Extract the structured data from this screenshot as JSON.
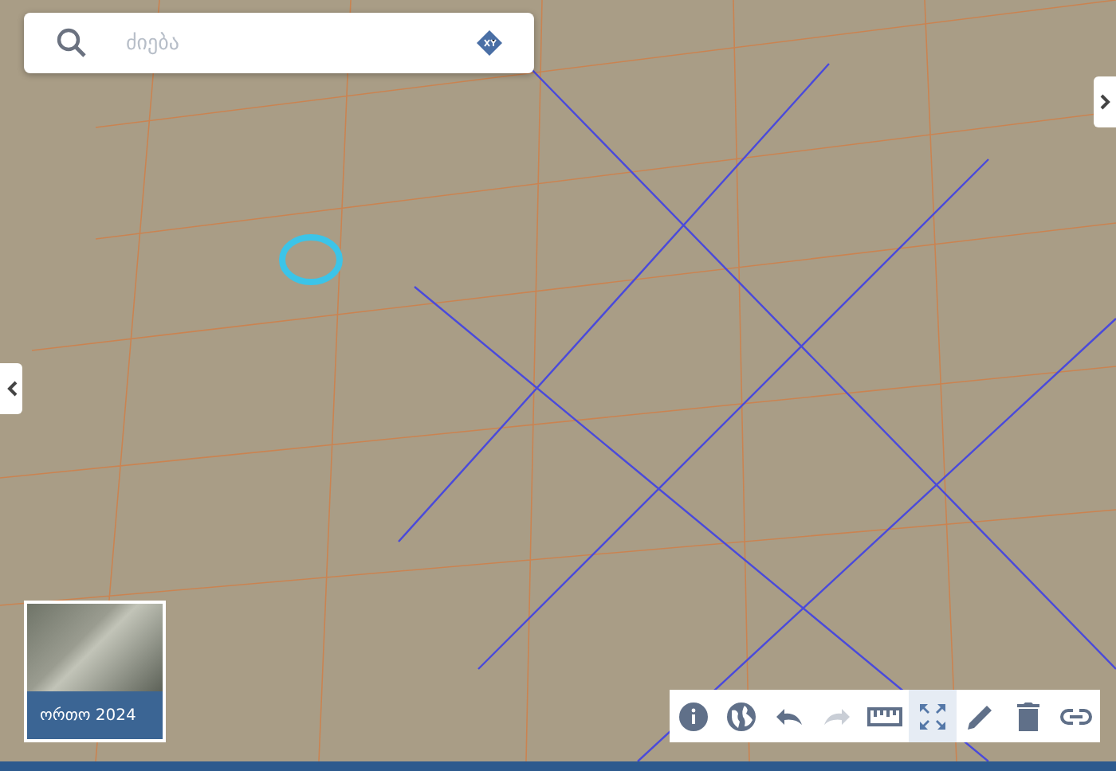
{
  "search": {
    "placeholder": "ძიება"
  },
  "basemap": {
    "label": "ორთო 2024"
  },
  "toolbar": [
    {
      "kind": "info",
      "selected": false,
      "disabled": false
    },
    {
      "kind": "globe",
      "selected": false,
      "disabled": false
    },
    {
      "kind": "undo",
      "selected": false,
      "disabled": false
    },
    {
      "kind": "redo",
      "selected": false,
      "disabled": true
    },
    {
      "kind": "ruler",
      "selected": false,
      "disabled": false
    },
    {
      "kind": "fullscreen",
      "selected": true,
      "disabled": false
    },
    {
      "kind": "pencil",
      "selected": false,
      "disabled": false
    },
    {
      "kind": "trash",
      "selected": false,
      "disabled": false
    },
    {
      "kind": "link",
      "selected": false,
      "disabled": false
    }
  ]
}
